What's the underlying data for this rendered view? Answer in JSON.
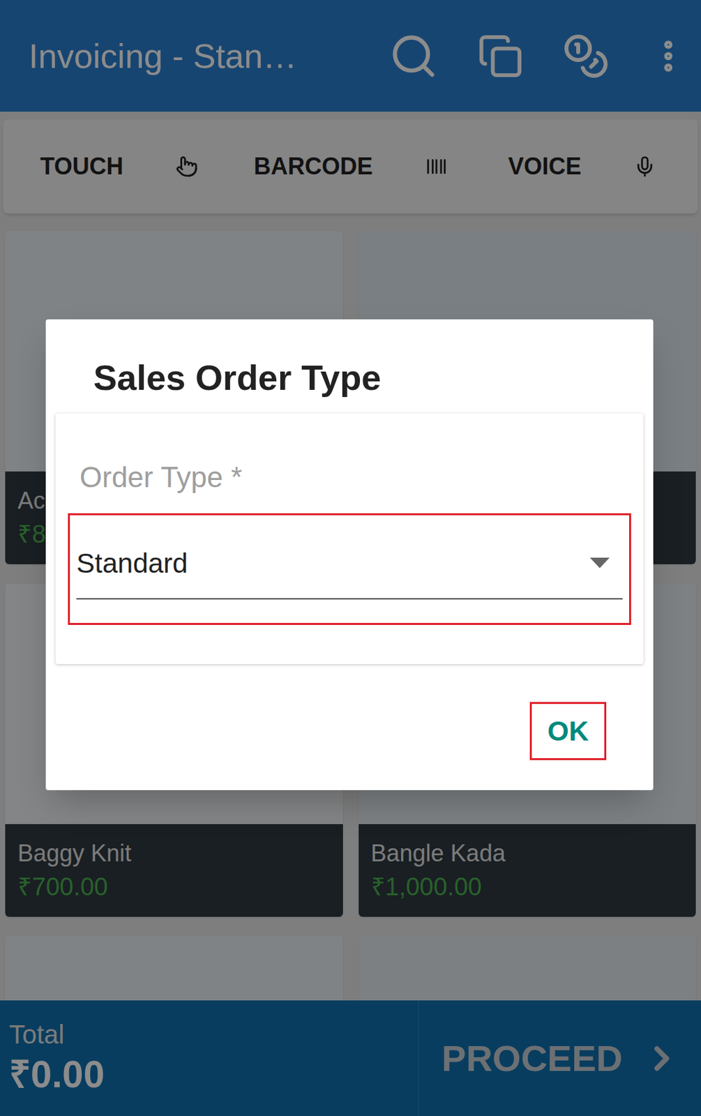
{
  "app_bar": {
    "title": "Invoicing - Stan…"
  },
  "input_modes": [
    {
      "label": "TOUCH",
      "kind": "touch"
    },
    {
      "label": "BARCODE",
      "kind": "barcode"
    },
    {
      "label": "VOICE",
      "kind": "voice"
    }
  ],
  "products": [
    {
      "name": "Acr",
      "price": "₹8"
    },
    {
      "name": "",
      "price": ""
    },
    {
      "name": "Baggy Knit",
      "price": "₹700.00"
    },
    {
      "name": "Bangle Kada",
      "price": "₹1,000.00"
    },
    {
      "name": "",
      "price": ""
    },
    {
      "name": "",
      "price": ""
    }
  ],
  "footer": {
    "total_label": "Total",
    "total": "₹0.00",
    "proceed": "PROCEED"
  },
  "dialog": {
    "title": "Sales Order Type",
    "field_label": "Order Type *",
    "value": "Standard",
    "button": "OK"
  }
}
